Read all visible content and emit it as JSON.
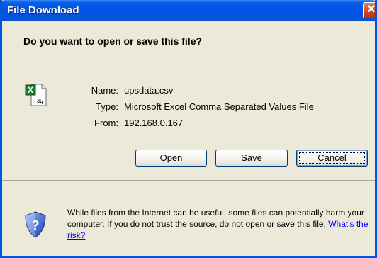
{
  "window": {
    "title": "File Download",
    "close_glyph": "✕"
  },
  "dialog": {
    "question": "Do you want to open or save this file?",
    "file_icon": "excel-csv-icon",
    "fields": {
      "name_label": "Name:",
      "name_value": "upsdata.csv",
      "type_label": "Type:",
      "type_value": "Microsoft Excel Comma Separated Values File",
      "from_label": "From:",
      "from_value": "192.168.0.167"
    },
    "buttons": {
      "open": "Open",
      "save": "Save",
      "cancel": "Cancel"
    },
    "warning": {
      "icon": "security-shield-icon",
      "text": "While files from the Internet can be useful, some files can potentially harm your computer. If you do not trust the source, do not open or save this file.",
      "link": "What's the risk?"
    }
  },
  "colors": {
    "titlebar": "#0054e3",
    "background": "#ece9d8",
    "link": "#0000ff"
  }
}
